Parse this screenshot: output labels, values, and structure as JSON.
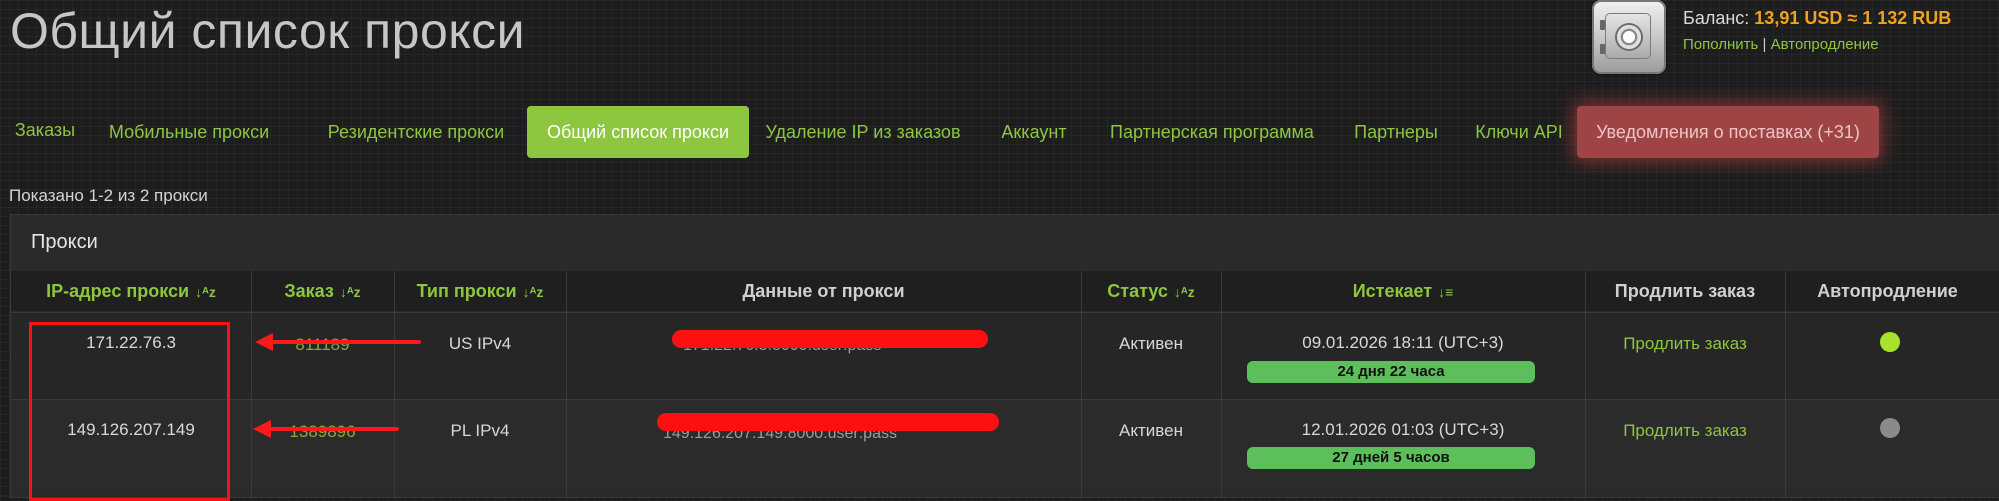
{
  "page": {
    "title": "Общий список прокси"
  },
  "balance": {
    "label": "Баланс:",
    "amount": "13,91 USD ≈ 1 132 RUB",
    "topup": "Пополнить",
    "separator": "|",
    "autorenew": "Автопродление"
  },
  "nav": {
    "tabs": [
      {
        "label": "Заказы"
      },
      {
        "label": "Мобильные прокси"
      },
      {
        "label": "Резидентские прокси"
      },
      {
        "label": "Общий список прокси",
        "active": true
      },
      {
        "label": "Удаление IP из заказов"
      },
      {
        "label": "Аккаунт"
      },
      {
        "label": "Партнерская программа"
      },
      {
        "label": "Партнеры"
      },
      {
        "label": "Ключи API"
      },
      {
        "label": "Уведомления о поставках (+31)"
      }
    ]
  },
  "summary": "Показано 1-2 из 2 прокси",
  "panel": {
    "title": "Прокси",
    "columns": [
      {
        "label": "IP-адрес прокси",
        "sort": "↓ᴬᴢ"
      },
      {
        "label": "Заказ",
        "sort": "↓ᴬᴢ"
      },
      {
        "label": "Тип прокси",
        "sort": "↓ᴬᴢ"
      },
      {
        "label": "Данные от прокси"
      },
      {
        "label": "Статус",
        "sort": "↓ᴬᴢ"
      },
      {
        "label": "Истекает",
        "sort": "↓≡"
      },
      {
        "label": "Продлить заказ"
      },
      {
        "label": "Автопродление"
      }
    ],
    "rows": [
      {
        "ip": "171.22.76.3",
        "order": "811189",
        "type": "US IPv4",
        "data": "171.22.76.3:8000:user:pass",
        "status": "Активен",
        "expires": "09.01.2026 18:11 (UTC+3)",
        "remaining": "24 дня 22 часа",
        "extend": "Продлить заказ",
        "autorenew_color": "#a8e22a"
      },
      {
        "ip": "149.126.207.149",
        "order": "1389896",
        "type": "PL IPv4",
        "data": "149.126.207.149:8000:user:pass",
        "status": "Активен",
        "expires": "12.01.2026 01:03 (UTC+3)",
        "remaining": "27 дней 5 часов",
        "extend": "Продлить заказ",
        "autorenew_color": "#8a8a8a"
      }
    ]
  }
}
